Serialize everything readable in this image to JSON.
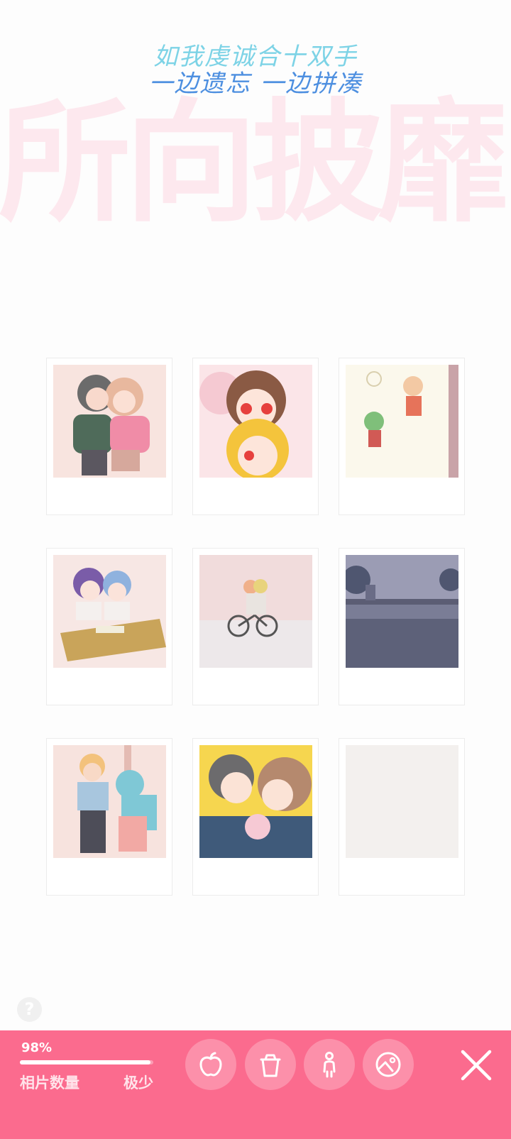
{
  "header": {
    "line1": "如我虔诚合十双手",
    "line2": "一边遗忘 一边拼凑"
  },
  "watermark": "所向披靡",
  "photos": [
    {
      "name": "couple-hug",
      "empty": false
    },
    {
      "name": "two-girls",
      "empty": false
    },
    {
      "name": "sketch-paper",
      "empty": false
    },
    {
      "name": "classroom-desk",
      "empty": false
    },
    {
      "name": "bicycle",
      "empty": false
    },
    {
      "name": "night-river",
      "empty": false
    },
    {
      "name": "cake-couple",
      "empty": false
    },
    {
      "name": "kiss-baby",
      "empty": false
    },
    {
      "name": "empty-slot",
      "empty": true
    }
  ],
  "help": {
    "icon": "question-icon",
    "glyph": "?"
  },
  "bottom_bar": {
    "progress_percent": "98%",
    "progress_value": 0.98,
    "count_label": "相片数量",
    "count_value": "极少",
    "tools": [
      {
        "name": "apple-icon"
      },
      {
        "name": "cup-icon"
      },
      {
        "name": "person-icon"
      },
      {
        "name": "photo-icon"
      }
    ],
    "close_icon": "close-icon"
  },
  "colors": {
    "accent": "#fb6b8e",
    "watermark": "#fde8ee",
    "header_line1": "#7dd3e6",
    "header_line2": "#4d8fe0"
  }
}
